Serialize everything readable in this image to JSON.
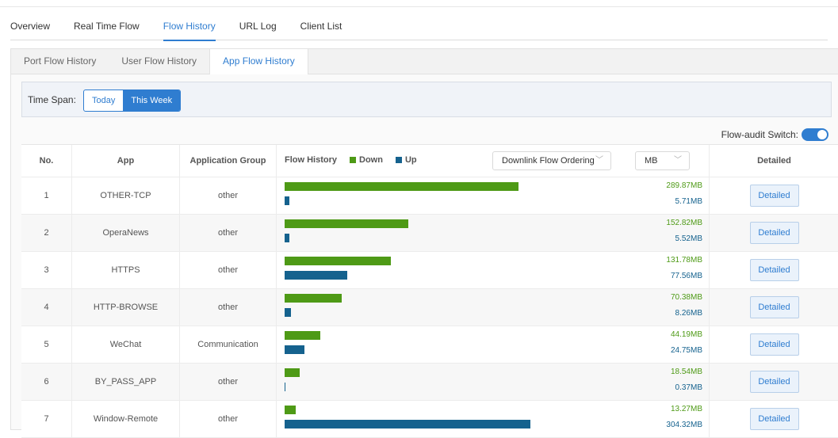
{
  "top_tabs": [
    {
      "label": "Overview"
    },
    {
      "label": "Real Time Flow"
    },
    {
      "label": "Flow History"
    },
    {
      "label": "URL Log"
    },
    {
      "label": "Client List"
    }
  ],
  "active_top_tab": 2,
  "sub_tabs": [
    {
      "label": "Port Flow History"
    },
    {
      "label": "User Flow History"
    },
    {
      "label": "App Flow History"
    }
  ],
  "active_sub_tab": 2,
  "time_span": {
    "label": "Time Span:",
    "options": [
      "Today",
      "This Week"
    ],
    "selected": "This Week"
  },
  "flow_audit": {
    "label": "Flow-audit Switch:",
    "enabled": true
  },
  "table": {
    "headers": {
      "no": "No.",
      "app": "App",
      "group": "Application Group",
      "flow": "Flow History",
      "detailed": "Detailed"
    },
    "legend": {
      "down": "Down",
      "up": "Up"
    },
    "ordering_select": "Downlink Flow Ordering",
    "unit_select": "MB",
    "colors": {
      "down": "#4e9a16",
      "up": "#15628e",
      "accent": "#2f7dd0"
    },
    "max_value_mb": 304.32,
    "rows": [
      {
        "no": "1",
        "app": "OTHER-TCP",
        "group": "other",
        "down_label": "289.87MB",
        "up_label": "5.71MB",
        "down_mb": 289.87,
        "up_mb": 5.71,
        "detail_label": "Detailed"
      },
      {
        "no": "2",
        "app": "OperaNews",
        "group": "other",
        "down_label": "152.82MB",
        "up_label": "5.52MB",
        "down_mb": 152.82,
        "up_mb": 5.52,
        "detail_label": "Detailed"
      },
      {
        "no": "3",
        "app": "HTTPS",
        "group": "other",
        "down_label": "131.78MB",
        "up_label": "77.56MB",
        "down_mb": 131.78,
        "up_mb": 77.56,
        "detail_label": "Detailed"
      },
      {
        "no": "4",
        "app": "HTTP-BROWSE",
        "group": "other",
        "down_label": "70.38MB",
        "up_label": "8.26MB",
        "down_mb": 70.38,
        "up_mb": 8.26,
        "detail_label": "Detailed"
      },
      {
        "no": "5",
        "app": "WeChat",
        "group": "Communication",
        "down_label": "44.19MB",
        "up_label": "24.75MB",
        "down_mb": 44.19,
        "up_mb": 24.75,
        "detail_label": "Detailed"
      },
      {
        "no": "6",
        "app": "BY_PASS_APP",
        "group": "other",
        "down_label": "18.54MB",
        "up_label": "0.37MB",
        "down_mb": 18.54,
        "up_mb": 0.37,
        "detail_label": "Detailed"
      },
      {
        "no": "7",
        "app": "Window-Remote",
        "group": "other",
        "down_label": "13.27MB",
        "up_label": "304.32MB",
        "down_mb": 13.27,
        "up_mb": 304.32,
        "detail_label": "Detailed"
      }
    ]
  }
}
